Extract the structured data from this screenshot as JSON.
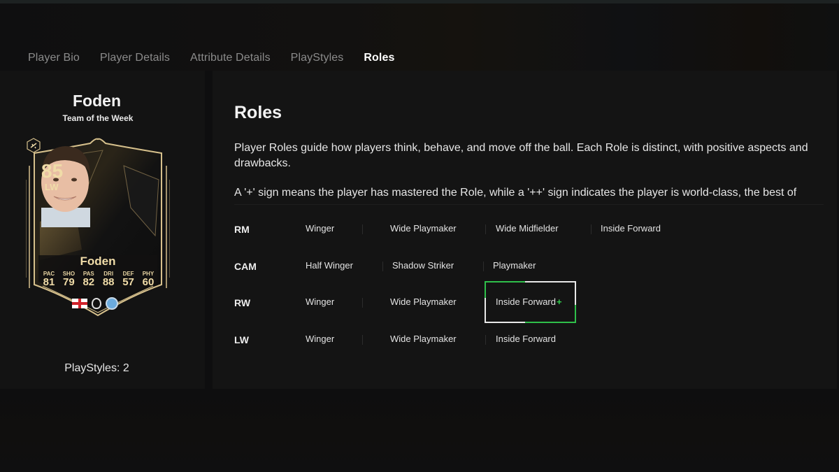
{
  "tabs": [
    {
      "label": "Player Bio",
      "active": false
    },
    {
      "label": "Player Details",
      "active": false
    },
    {
      "label": "Attribute Details",
      "active": false
    },
    {
      "label": "PlayStyles",
      "active": false
    },
    {
      "label": "Roles",
      "active": true
    }
  ],
  "player": {
    "name": "Foden",
    "subtitle": "Team of the Week",
    "playstyles_label": "PlayStyles: 2",
    "card": {
      "rating": "85",
      "position": "LW",
      "name": "Foden",
      "stats": [
        {
          "label": "PAC",
          "value": "81"
        },
        {
          "label": "SHO",
          "value": "79"
        },
        {
          "label": "PAS",
          "value": "82"
        },
        {
          "label": "DRI",
          "value": "88"
        },
        {
          "label": "DEF",
          "value": "57"
        },
        {
          "label": "PHY",
          "value": "60"
        }
      ],
      "nation": "England",
      "league": "Premier League",
      "club": "Manchester City",
      "colors": {
        "gold": "#f0dca8",
        "card_bg": "#161512"
      }
    }
  },
  "roles": {
    "title": "Roles",
    "description": "Player Roles guide how players think, behave, and move off the ball. Each Role is distinct, with positive aspects and drawbacks.",
    "note": "A '+' sign means the player has mastered the Role, while a '++' sign indicates the player is world-class, the best of",
    "rows": [
      {
        "position": "RM",
        "roles": [
          {
            "name": "Winger",
            "plus": ""
          },
          {
            "name": "Wide Playmaker",
            "plus": ""
          },
          {
            "name": "Wide Midfielder",
            "plus": ""
          },
          {
            "name": "Inside Forward",
            "plus": ""
          }
        ]
      },
      {
        "position": "CAM",
        "roles": [
          {
            "name": "Half Winger",
            "plus": ""
          },
          {
            "name": "Shadow Striker",
            "plus": ""
          },
          {
            "name": "Playmaker",
            "plus": ""
          }
        ]
      },
      {
        "position": "RW",
        "roles": [
          {
            "name": "Winger",
            "plus": ""
          },
          {
            "name": "Wide Playmaker",
            "plus": ""
          },
          {
            "name": "Inside Forward",
            "plus": "+",
            "selected": true
          }
        ]
      },
      {
        "position": "LW",
        "roles": [
          {
            "name": "Winger",
            "plus": ""
          },
          {
            "name": "Wide Playmaker",
            "plus": ""
          },
          {
            "name": "Inside Forward",
            "plus": ""
          }
        ]
      }
    ],
    "colors": {
      "plus": "#33d04f",
      "selection_green": "#2fbf4a",
      "selection_white": "#e8e8e8"
    }
  }
}
